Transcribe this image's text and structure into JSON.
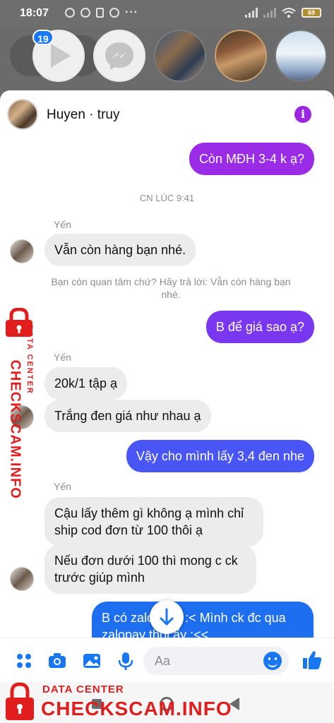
{
  "status_bar": {
    "time": "18:07",
    "battery": "69"
  },
  "chat_heads": {
    "badge_count": "19",
    "items": [
      "play-app",
      "messenger",
      "contact-photo-1",
      "contact-photo-2",
      "contact-photo-3"
    ]
  },
  "header": {
    "title": "Huyen · truy",
    "info_icon": "info-icon"
  },
  "conversation": {
    "messages": [
      {
        "dir": "out",
        "text": "Còn MĐH 3-4 k ạ?"
      },
      {
        "type": "timestamp",
        "text": "CN LÚC 9:41"
      },
      {
        "type": "sender",
        "text": "Yến"
      },
      {
        "dir": "in",
        "text": "Vẫn còn hàng bạn nhé."
      },
      {
        "type": "note",
        "text": "Bạn còn quan tâm chứ? Hãy trả lời: Vẫn còn hàng bạn nhé."
      },
      {
        "dir": "out",
        "text": "B để giá sao ạ?"
      },
      {
        "type": "sender",
        "text": "Yến"
      },
      {
        "dir": "in",
        "text": "20k/1 tập ạ"
      },
      {
        "dir": "in",
        "text": "Trắng đen giá như nhau ạ"
      },
      {
        "dir": "out",
        "text": "Vậy cho mình lấy 3,4 đen nhe"
      },
      {
        "type": "sender",
        "text": "Yến"
      },
      {
        "dir": "in",
        "text": "Cậu lấy thêm gì không ạ mình chỉ ship cod đơn từ 100 thôi ạ"
      },
      {
        "dir": "in",
        "text": "Nếu đơn dưới 100 thì mong c ck trước giúp mình"
      },
      {
        "dir": "out",
        "text": "B có zalo k ạ? :< Mình ck đc qua zalopay thoi ấy :<<"
      }
    ]
  },
  "composer": {
    "placeholder": "Aa",
    "icons": [
      "menu-dots-icon",
      "camera-icon",
      "image-icon",
      "mic-icon",
      "emoji-icon",
      "like-icon"
    ]
  },
  "watermark": {
    "side_main": "CHECKSCAM.INFO",
    "side_sub": "DATA CENTER",
    "bottom_sub": "DATA CENTER",
    "bottom_main": "CHECKSCAM.INFO"
  },
  "colors": {
    "outgoing_bubble_top": "#9a2ce8",
    "outgoing_bubble_mid": "#6a3ff5",
    "outgoing_bubble_bottom": "#1e6ff0",
    "incoming_bubble": "#ececec",
    "accent": "#1877f2",
    "watermark": "#e01e1e"
  }
}
